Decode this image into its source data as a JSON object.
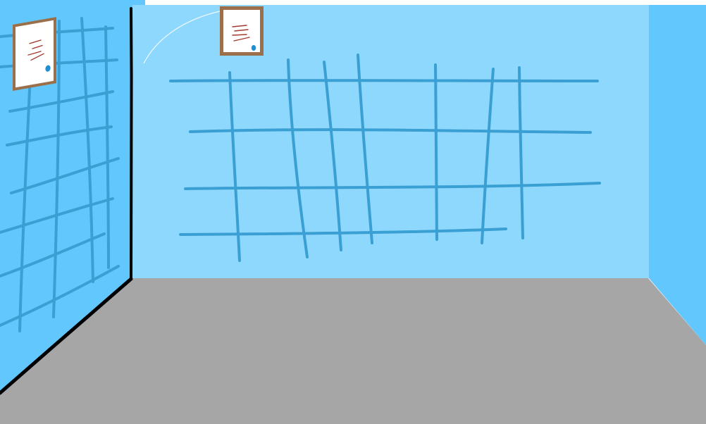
{
  "scene": {
    "colors": {
      "back_wall": "#8fd8fd",
      "left_wall": "#62c7fc",
      "right_wall": "#62c7fc",
      "floor": "#a6a6a6",
      "grid_lines": "#3a9fd3",
      "edge_lines": "#000000",
      "frame": "#9b6f4a",
      "paper": "#ffffff",
      "scribble": "#a33a2e",
      "pin": "#1f8fd6"
    },
    "objects": [
      "back-wall",
      "left-wall",
      "right-wall",
      "floor",
      "wall-grid",
      "notice-board"
    ]
  }
}
